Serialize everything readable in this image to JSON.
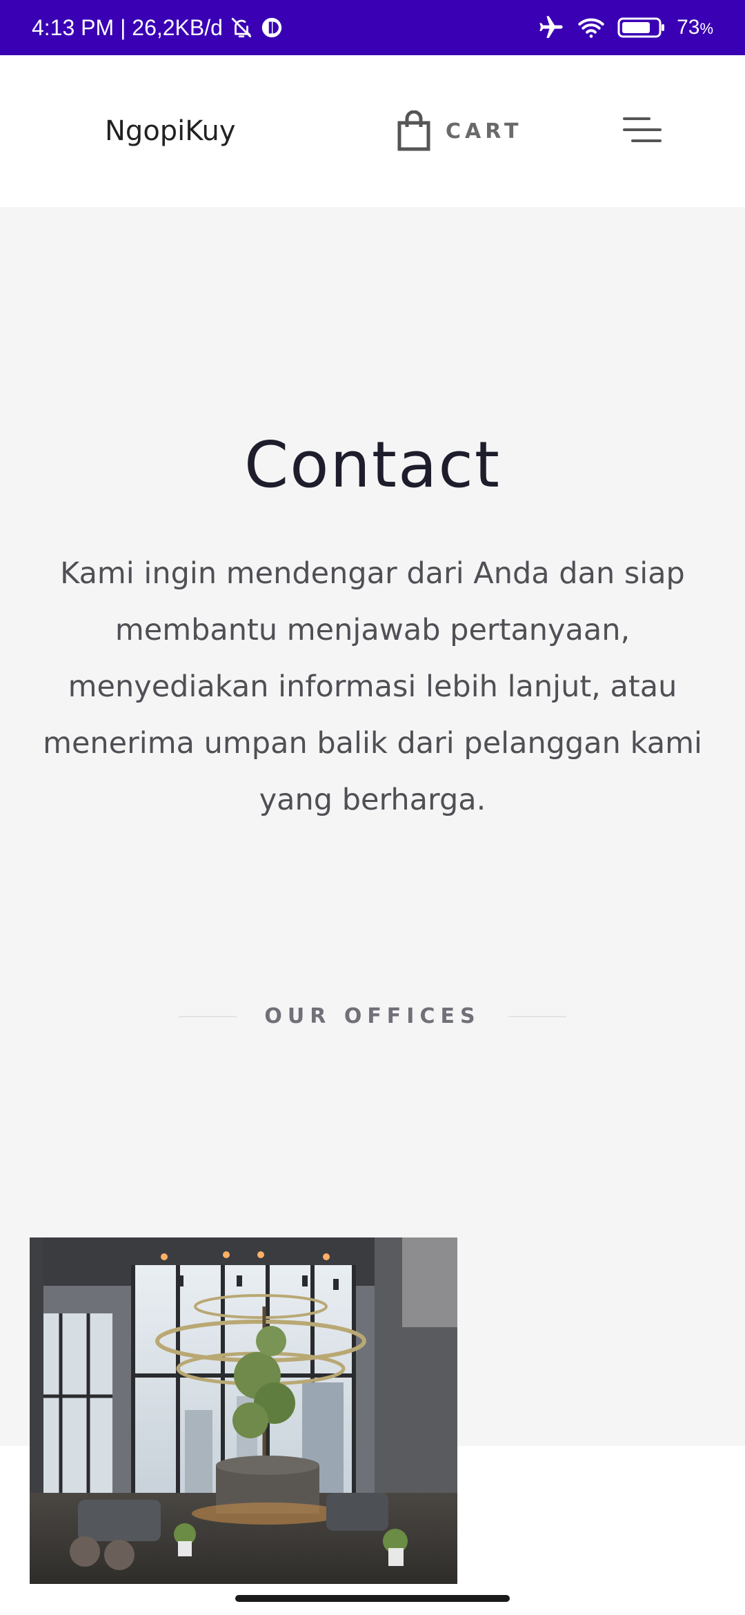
{
  "status_bar": {
    "time_info": "4:13 PM | 26,2KB/d",
    "battery_percent": "73",
    "battery_unit": "%",
    "background_color": "#3a00b4",
    "icons": [
      "bell-off-icon",
      "data-saver-icon",
      "airplane-icon",
      "wifi-icon",
      "battery-icon"
    ]
  },
  "header": {
    "brand": "NgopiKuy",
    "cart_label": "CART",
    "cart_icon": "shopping-bag-icon",
    "menu_icon": "hamburger-menu-icon"
  },
  "hero": {
    "title": "Contact",
    "description": "Kami ingin mendengar dari Anda dan siap membantu menjawab pertanyaan, menyediakan informasi lebih lanjut, atau menerima umpan balik dari pelanggan kami yang berharga."
  },
  "offices": {
    "heading": "OUR OFFICES"
  },
  "colors": {
    "accent": "#3a00b4",
    "section_bg": "#f5f5f6",
    "title": "#1d1d2b",
    "body_text": "#4f4f55"
  }
}
